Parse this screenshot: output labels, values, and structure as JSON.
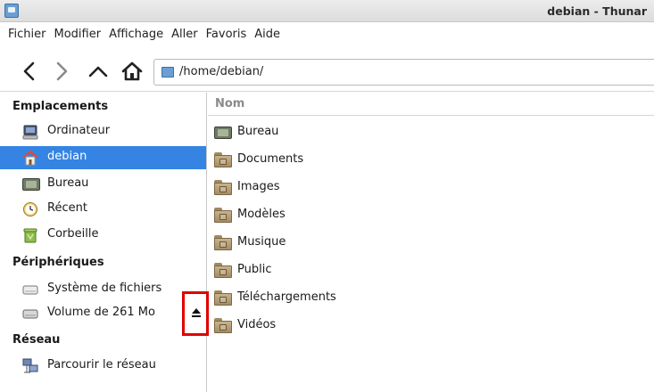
{
  "window": {
    "title": "debian - Thunar",
    "app_icon": "thunar-window-icon"
  },
  "menu": [
    "Fichier",
    "Modifier",
    "Affichage",
    "Aller",
    "Favoris",
    "Aide"
  ],
  "toolbar": {
    "back_icon": "chevron-left-icon",
    "forward_icon": "chevron-right-icon",
    "up_icon": "arrow-up-icon",
    "home_icon": "home-icon",
    "location": "/home/debian/"
  },
  "sidebar": {
    "sections": {
      "places": "Emplacements",
      "devices": "Périphériques",
      "network": "Réseau"
    },
    "places": [
      {
        "label": "Ordinateur",
        "icon": "computer-icon",
        "selected": false
      },
      {
        "label": "debian",
        "icon": "home-folder-icon",
        "selected": true
      },
      {
        "label": "Bureau",
        "icon": "desktop-icon",
        "selected": false
      },
      {
        "label": "Récent",
        "icon": "recent-clock-icon",
        "selected": false
      },
      {
        "label": "Corbeille",
        "icon": "trash-icon",
        "selected": false
      }
    ],
    "devices": [
      {
        "label": "Système de fichiers",
        "icon": "drive-icon"
      },
      {
        "label": "Volume de 261 Mo",
        "icon": "volume-drive-icon",
        "eject_icon": "eject-icon"
      }
    ],
    "network": [
      {
        "label": "Parcourir le réseau",
        "icon": "network-icon"
      }
    ]
  },
  "file_list": {
    "column_header": "Nom",
    "items": [
      {
        "name": "Bureau",
        "icon": "desktop-icon"
      },
      {
        "name": "Documents",
        "icon": "folder-documents-icon"
      },
      {
        "name": "Images",
        "icon": "folder-images-icon"
      },
      {
        "name": "Modèles",
        "icon": "folder-templates-icon"
      },
      {
        "name": "Musique",
        "icon": "folder-music-icon"
      },
      {
        "name": "Public",
        "icon": "folder-public-icon"
      },
      {
        "name": "Téléchargements",
        "icon": "folder-downloads-icon"
      },
      {
        "name": "Vidéos",
        "icon": "folder-videos-icon"
      }
    ]
  },
  "colors": {
    "selection": "#3584e4",
    "highlight_box": "#e00000"
  }
}
